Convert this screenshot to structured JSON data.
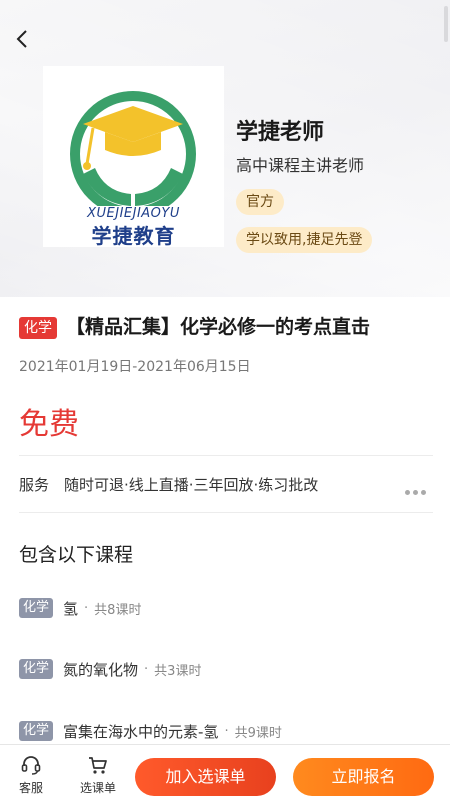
{
  "teacher": {
    "name": "学捷老师",
    "title": "高中课程主讲老师",
    "tags": [
      "官方",
      "学以致用,捷足先登"
    ],
    "logo": {
      "en": "XUEJIEJIAOYU",
      "cn": "学捷教育"
    }
  },
  "course": {
    "subject": "化学",
    "title": "【精品汇集】化学必修一的考点直击",
    "date_range": "2021年01月19日-2021年06月15日",
    "price": "免费",
    "service_label": "服务",
    "service_value": "随时可退·线上直播·三年回放·练习批改"
  },
  "lessons_section": {
    "title": "包含以下课程",
    "items": [
      {
        "subject": "化学",
        "name": "氢",
        "sep": "·",
        "count": "共8课时"
      },
      {
        "subject": "化学",
        "name": "氮的氧化物",
        "sep": "·",
        "count": "共3课时"
      },
      {
        "subject": "化学",
        "name": "富集在海水中的元素-氢",
        "sep": "·",
        "count": "共9课时"
      }
    ]
  },
  "bottom_bar": {
    "service": "客服",
    "cart": "选课单",
    "add_button": "加入选课单",
    "enroll_button": "立即报名"
  },
  "colors": {
    "accent_red": "#e53935",
    "button_add": "#f04a22",
    "button_enroll": "#ff7a18",
    "tag_bg": "#fdebc8",
    "logo_green": "#3aa06a",
    "logo_yellow": "#f3c22b",
    "logo_blue": "#1f3f8a"
  }
}
